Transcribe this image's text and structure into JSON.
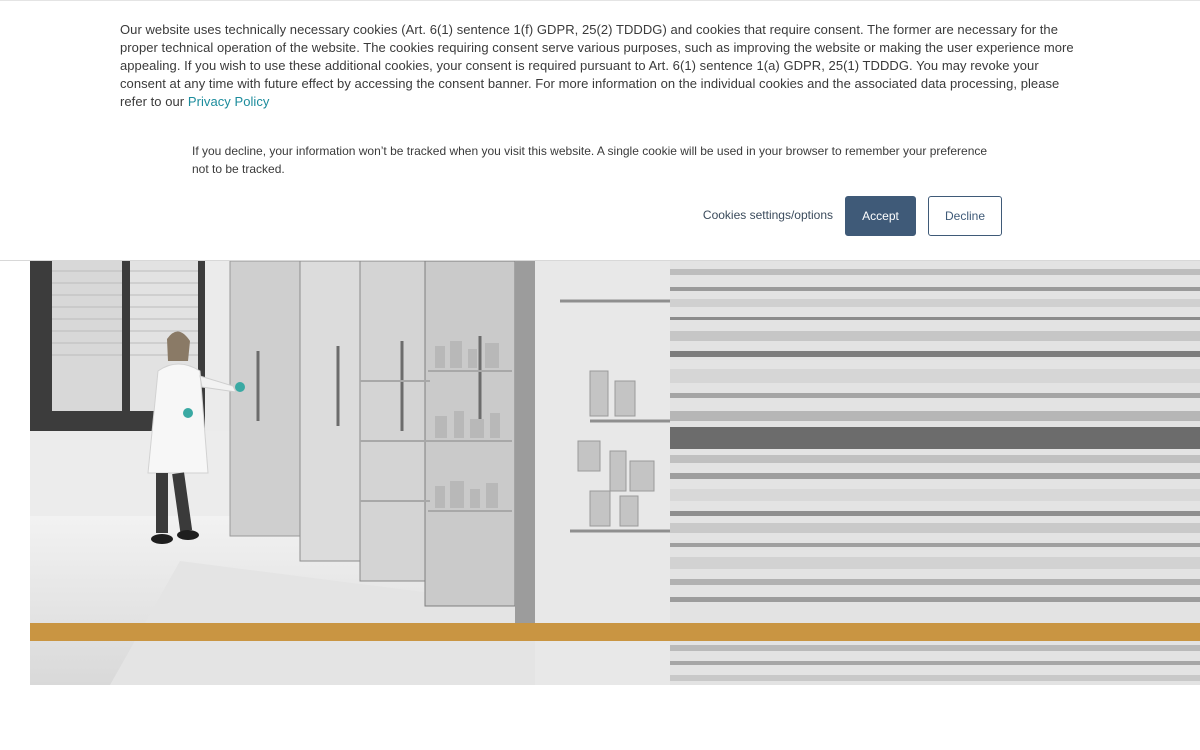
{
  "cookie_banner": {
    "main_text": "Our website uses technically necessary cookies (Art. 6(1) sentence 1(f) GDPR, 25(2) TDDDG) and cookies that require consent. The former are necessary for the proper technical operation of the website. The cookies requiring consent serve various purposes, such as improving the website or making the user experience more appealing. If you wish to use these additional cookies, your consent is required pursuant to Art. 6(1) sentence 1(a) GDPR, 25(1) TDDDG. You may revoke your consent at any time with future effect by accessing the consent banner. For more information on the individual cookies and the associated data processing, please refer to our",
    "privacy_link": "Privacy Policy",
    "decline_info": "If you decline, your information won’t be tracked when you visit this website. A single cookie will be used in your browser to remember your preference not to be tracked.",
    "settings_label": "Cookies settings/options",
    "accept_label": "Accept",
    "decline_label": "Decline"
  },
  "colors": {
    "accent_button": "#3f5a78",
    "link": "#1c8c9c",
    "gold_band": "#c99542"
  }
}
